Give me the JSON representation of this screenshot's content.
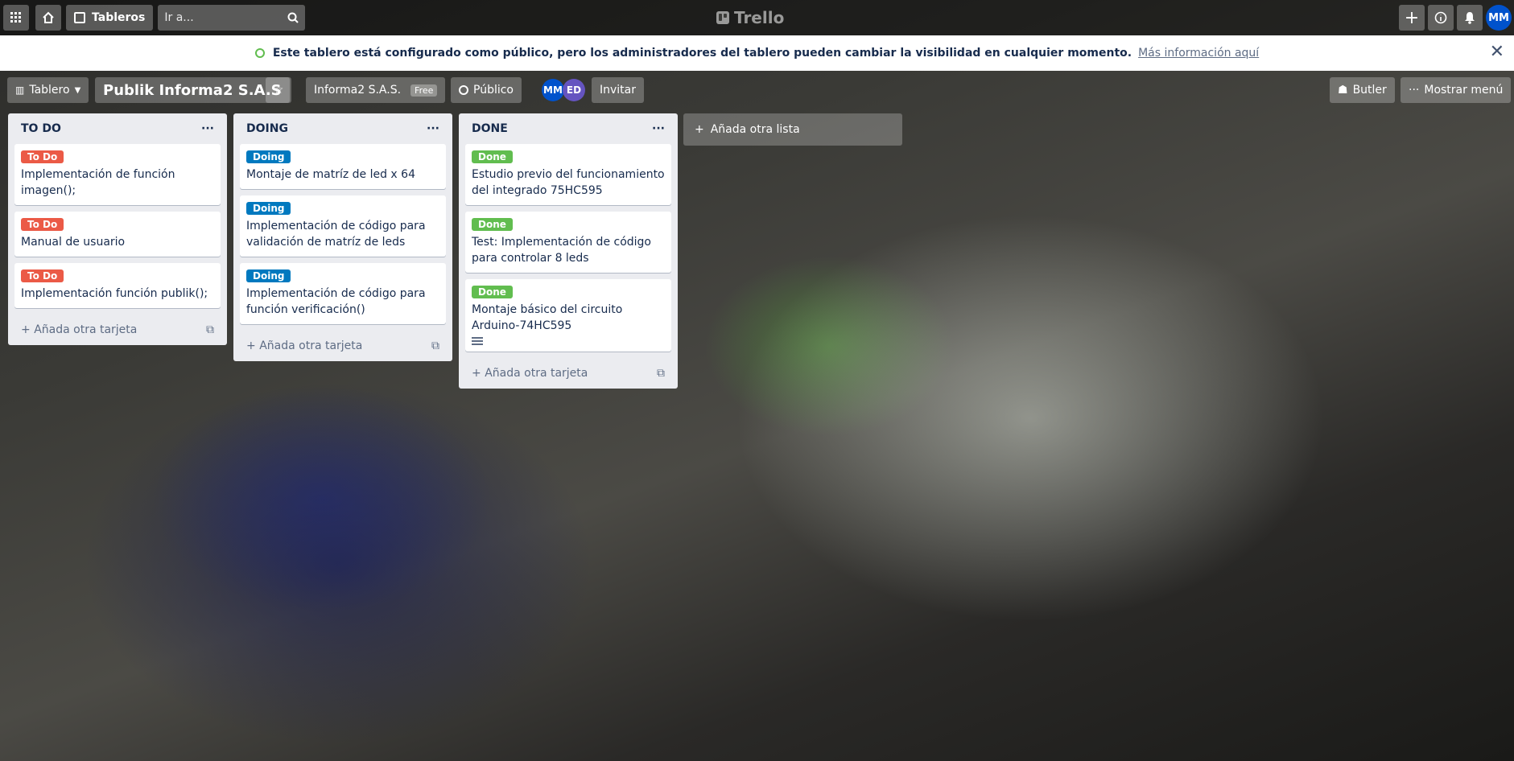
{
  "header": {
    "boards_label": "Tableros",
    "search_placeholder": "Ir a...",
    "logo_text": "Trello",
    "user_initials": "MM"
  },
  "banner": {
    "message": "Este tablero está configurado como público, pero los administradores del tablero pueden cambiar la visibilidad en cualquier momento.",
    "link": "Más información aquí"
  },
  "board": {
    "view_label": "Tablero",
    "title": "Publik Informa2 S.A.S",
    "workspace": "Informa2 S.A.S.",
    "workspace_badge": "Free",
    "visibility": "Público",
    "members": [
      "MM",
      "ED"
    ],
    "invite_label": "Invitar",
    "butler_label": "Butler",
    "menu_label": "Mostrar menú"
  },
  "lists": [
    {
      "title": "TO DO",
      "cards": [
        {
          "label": "To Do",
          "text": "Implementación de función imagen();"
        },
        {
          "label": "To Do",
          "text": "Manual de usuario"
        },
        {
          "label": "To Do",
          "text": "Implementación función publik();"
        }
      ],
      "add_card": "Añada otra tarjeta"
    },
    {
      "title": "DOING",
      "cards": [
        {
          "label": "Doing",
          "text": "Montaje de matríz de led x 64"
        },
        {
          "label": "Doing",
          "text": "Implementación de código para validación de matríz de leds"
        },
        {
          "label": "Doing",
          "text": "Implementación de código para función verificación()"
        }
      ],
      "add_card": "Añada otra tarjeta"
    },
    {
      "title": "DONE",
      "cards": [
        {
          "label": "Done",
          "text": "Estudio previo del funcionamiento del integrado 75HC595"
        },
        {
          "label": "Done",
          "text": "Test: Implementación de código para controlar 8 leds"
        },
        {
          "label": "Done",
          "text": "Montaje básico del circuito Arduino-74HC595"
        }
      ],
      "add_card": "Añada otra tarjeta"
    }
  ],
  "add_list": "Añada otra lista",
  "colors": {
    "todo": "#eb5a46",
    "doing": "#0079bf",
    "done": "#61bd4f"
  }
}
